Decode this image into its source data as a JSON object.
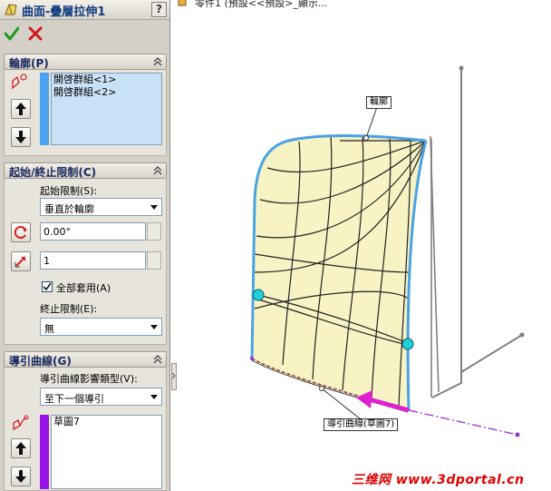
{
  "title": "曲面-疊層拉伸1",
  "help_label": "?",
  "profile_group": {
    "label": "輪廓(P)",
    "items": [
      "開啓群組<1>",
      "開啓群組<2>"
    ]
  },
  "constraints_group": {
    "label": "起始/終止限制(C)",
    "start_label": "起始限制(S):",
    "start_value": "垂直於輪廓",
    "angle_value": "0.00°",
    "tangent_length": "1",
    "apply_all_label": "全部套用(A)",
    "apply_all_checked": true,
    "end_label": "終止限制(E):",
    "end_value": "無"
  },
  "guide_group": {
    "label": "導引曲線(G)",
    "influence_label": "導引曲線影響類型(V):",
    "influence_value": "至下一個導引",
    "items": [
      "草圖7"
    ]
  },
  "graphics": {
    "tree_label": "零件1 (預設<<預設>_顯示...",
    "profile_callout": "輪廓",
    "guide_callout": "導引曲線(草圖7)"
  },
  "watermark": "三维网 www.3dportal.cn",
  "colors": {
    "surface_fill": "#f7f3c4",
    "profile_edge": "#4aa3e6",
    "guide_magenta": "#e020d0",
    "guide_dashed": "#9b2fd0",
    "handle_cyan": "#1fd0d8",
    "panel_bg": "#d4d0c8",
    "list_bg": "#c9e1f6",
    "profile_stripe": "#4aa3f0",
    "guide_stripe": "#9a12e8",
    "watermark_red": "#e00000"
  }
}
